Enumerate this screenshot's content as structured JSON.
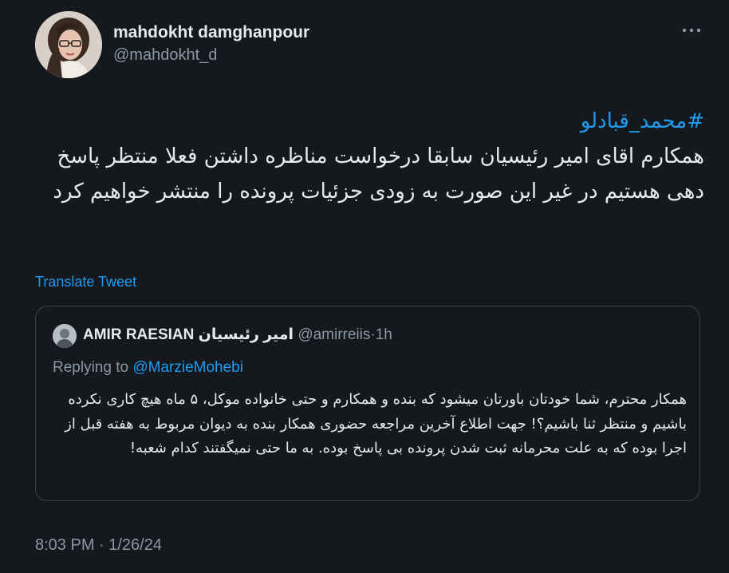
{
  "author": {
    "display_name": "mahdokht damghanpour",
    "handle": "@mahdokht_d"
  },
  "tweet": {
    "hashtag": "#محمد_قبادلو",
    "body": "همکارم اقای امیر رئیسیان سابقا درخواست مناظره داشتن فعلا منتظر پاسخ دهی هستیم در غیر این صورت به زودی جزئیات پرونده را منتشر خواهیم کرد"
  },
  "translate_label": "Translate Tweet",
  "quoted_tweet": {
    "name": "AMIR RAESIAN امیر رئیسیان",
    "handle": "@amirreiis",
    "separator": "·",
    "time": "1h",
    "replying_prefix": "Replying to ",
    "replying_to": "@MarzieMohebi",
    "body": "همکار محترم، شما خودتان باورتان میشود که بنده و همکارم و حتی خانواده موکل، ۵ ماه هیچ کاری نکرده باشیم و منتظر ثنا باشیم؟! جهت اطلاع آخرین مراجعه حضوری همکار بنده به دیوان مربوط به هفته قبل از اجرا بوده که به علت محرمانه ثبت شدن پرونده بی پاسخ بوده. به ما حتی نمیگفتند کدام شعبه!"
  },
  "timestamp": "8:03 PM · 1/26/24",
  "icons": {
    "avatar": "profile-photo",
    "more": "more-dots-icon"
  },
  "colors": {
    "background": "#15181c",
    "text": "#e7e9ea",
    "muted": "#8b98a5",
    "accent": "#1d9bf0",
    "border": "#3b4046"
  }
}
